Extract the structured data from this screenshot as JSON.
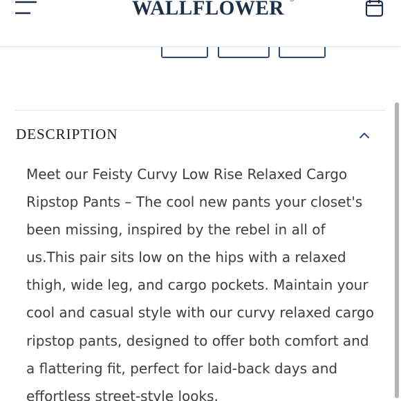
{
  "header": {
    "logo_text": "WALLFLOWER",
    "logo_mark": "®",
    "menu_icon": "hamburger-menu-icon",
    "cart_icon": "shopping-bag-icon"
  },
  "description": {
    "title": "DESCRIPTION",
    "toggle_icon": "chevron-up-icon",
    "lines": [
      "Meet our Feisty Curvy Low Rise Relaxed Cargo",
      "Ripstop Pants – The cool new pants your closet's",
      "been missing, inspired by the rebel in all of",
      "us.This pair sits low on the hips with a relaxed",
      "thigh, wide leg, and cargo pockets. Maintain your",
      "cool and casual style with our curvy relaxed cargo",
      "ripstop pants, designed to offer both comfort and",
      "a flattering fit, perfect for laid-back days and",
      "effortless street-style looks."
    ]
  },
  "colors": {
    "brand_navy": "#1c2f4a",
    "accent_blue": "#2a4d7c",
    "body_text": "#3d3d3d"
  }
}
